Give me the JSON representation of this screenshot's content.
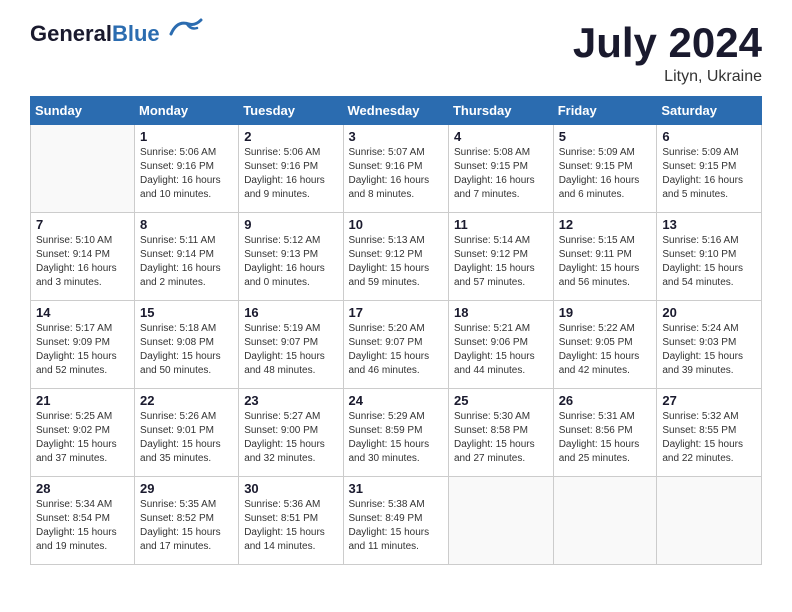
{
  "header": {
    "logo_general": "General",
    "logo_blue": "Blue",
    "month_title": "July 2024",
    "location": "Lityn, Ukraine"
  },
  "days_of_week": [
    "Sunday",
    "Monday",
    "Tuesday",
    "Wednesday",
    "Thursday",
    "Friday",
    "Saturday"
  ],
  "weeks": [
    [
      {
        "day": "",
        "info": ""
      },
      {
        "day": "1",
        "info": "Sunrise: 5:06 AM\nSunset: 9:16 PM\nDaylight: 16 hours\nand 10 minutes."
      },
      {
        "day": "2",
        "info": "Sunrise: 5:06 AM\nSunset: 9:16 PM\nDaylight: 16 hours\nand 9 minutes."
      },
      {
        "day": "3",
        "info": "Sunrise: 5:07 AM\nSunset: 9:16 PM\nDaylight: 16 hours\nand 8 minutes."
      },
      {
        "day": "4",
        "info": "Sunrise: 5:08 AM\nSunset: 9:15 PM\nDaylight: 16 hours\nand 7 minutes."
      },
      {
        "day": "5",
        "info": "Sunrise: 5:09 AM\nSunset: 9:15 PM\nDaylight: 16 hours\nand 6 minutes."
      },
      {
        "day": "6",
        "info": "Sunrise: 5:09 AM\nSunset: 9:15 PM\nDaylight: 16 hours\nand 5 minutes."
      }
    ],
    [
      {
        "day": "7",
        "info": "Sunrise: 5:10 AM\nSunset: 9:14 PM\nDaylight: 16 hours\nand 3 minutes."
      },
      {
        "day": "8",
        "info": "Sunrise: 5:11 AM\nSunset: 9:14 PM\nDaylight: 16 hours\nand 2 minutes."
      },
      {
        "day": "9",
        "info": "Sunrise: 5:12 AM\nSunset: 9:13 PM\nDaylight: 16 hours\nand 0 minutes."
      },
      {
        "day": "10",
        "info": "Sunrise: 5:13 AM\nSunset: 9:12 PM\nDaylight: 15 hours\nand 59 minutes."
      },
      {
        "day": "11",
        "info": "Sunrise: 5:14 AM\nSunset: 9:12 PM\nDaylight: 15 hours\nand 57 minutes."
      },
      {
        "day": "12",
        "info": "Sunrise: 5:15 AM\nSunset: 9:11 PM\nDaylight: 15 hours\nand 56 minutes."
      },
      {
        "day": "13",
        "info": "Sunrise: 5:16 AM\nSunset: 9:10 PM\nDaylight: 15 hours\nand 54 minutes."
      }
    ],
    [
      {
        "day": "14",
        "info": "Sunrise: 5:17 AM\nSunset: 9:09 PM\nDaylight: 15 hours\nand 52 minutes."
      },
      {
        "day": "15",
        "info": "Sunrise: 5:18 AM\nSunset: 9:08 PM\nDaylight: 15 hours\nand 50 minutes."
      },
      {
        "day": "16",
        "info": "Sunrise: 5:19 AM\nSunset: 9:07 PM\nDaylight: 15 hours\nand 48 minutes."
      },
      {
        "day": "17",
        "info": "Sunrise: 5:20 AM\nSunset: 9:07 PM\nDaylight: 15 hours\nand 46 minutes."
      },
      {
        "day": "18",
        "info": "Sunrise: 5:21 AM\nSunset: 9:06 PM\nDaylight: 15 hours\nand 44 minutes."
      },
      {
        "day": "19",
        "info": "Sunrise: 5:22 AM\nSunset: 9:05 PM\nDaylight: 15 hours\nand 42 minutes."
      },
      {
        "day": "20",
        "info": "Sunrise: 5:24 AM\nSunset: 9:03 PM\nDaylight: 15 hours\nand 39 minutes."
      }
    ],
    [
      {
        "day": "21",
        "info": "Sunrise: 5:25 AM\nSunset: 9:02 PM\nDaylight: 15 hours\nand 37 minutes."
      },
      {
        "day": "22",
        "info": "Sunrise: 5:26 AM\nSunset: 9:01 PM\nDaylight: 15 hours\nand 35 minutes."
      },
      {
        "day": "23",
        "info": "Sunrise: 5:27 AM\nSunset: 9:00 PM\nDaylight: 15 hours\nand 32 minutes."
      },
      {
        "day": "24",
        "info": "Sunrise: 5:29 AM\nSunset: 8:59 PM\nDaylight: 15 hours\nand 30 minutes."
      },
      {
        "day": "25",
        "info": "Sunrise: 5:30 AM\nSunset: 8:58 PM\nDaylight: 15 hours\nand 27 minutes."
      },
      {
        "day": "26",
        "info": "Sunrise: 5:31 AM\nSunset: 8:56 PM\nDaylight: 15 hours\nand 25 minutes."
      },
      {
        "day": "27",
        "info": "Sunrise: 5:32 AM\nSunset: 8:55 PM\nDaylight: 15 hours\nand 22 minutes."
      }
    ],
    [
      {
        "day": "28",
        "info": "Sunrise: 5:34 AM\nSunset: 8:54 PM\nDaylight: 15 hours\nand 19 minutes."
      },
      {
        "day": "29",
        "info": "Sunrise: 5:35 AM\nSunset: 8:52 PM\nDaylight: 15 hours\nand 17 minutes."
      },
      {
        "day": "30",
        "info": "Sunrise: 5:36 AM\nSunset: 8:51 PM\nDaylight: 15 hours\nand 14 minutes."
      },
      {
        "day": "31",
        "info": "Sunrise: 5:38 AM\nSunset: 8:49 PM\nDaylight: 15 hours\nand 11 minutes."
      },
      {
        "day": "",
        "info": ""
      },
      {
        "day": "",
        "info": ""
      },
      {
        "day": "",
        "info": ""
      }
    ]
  ]
}
